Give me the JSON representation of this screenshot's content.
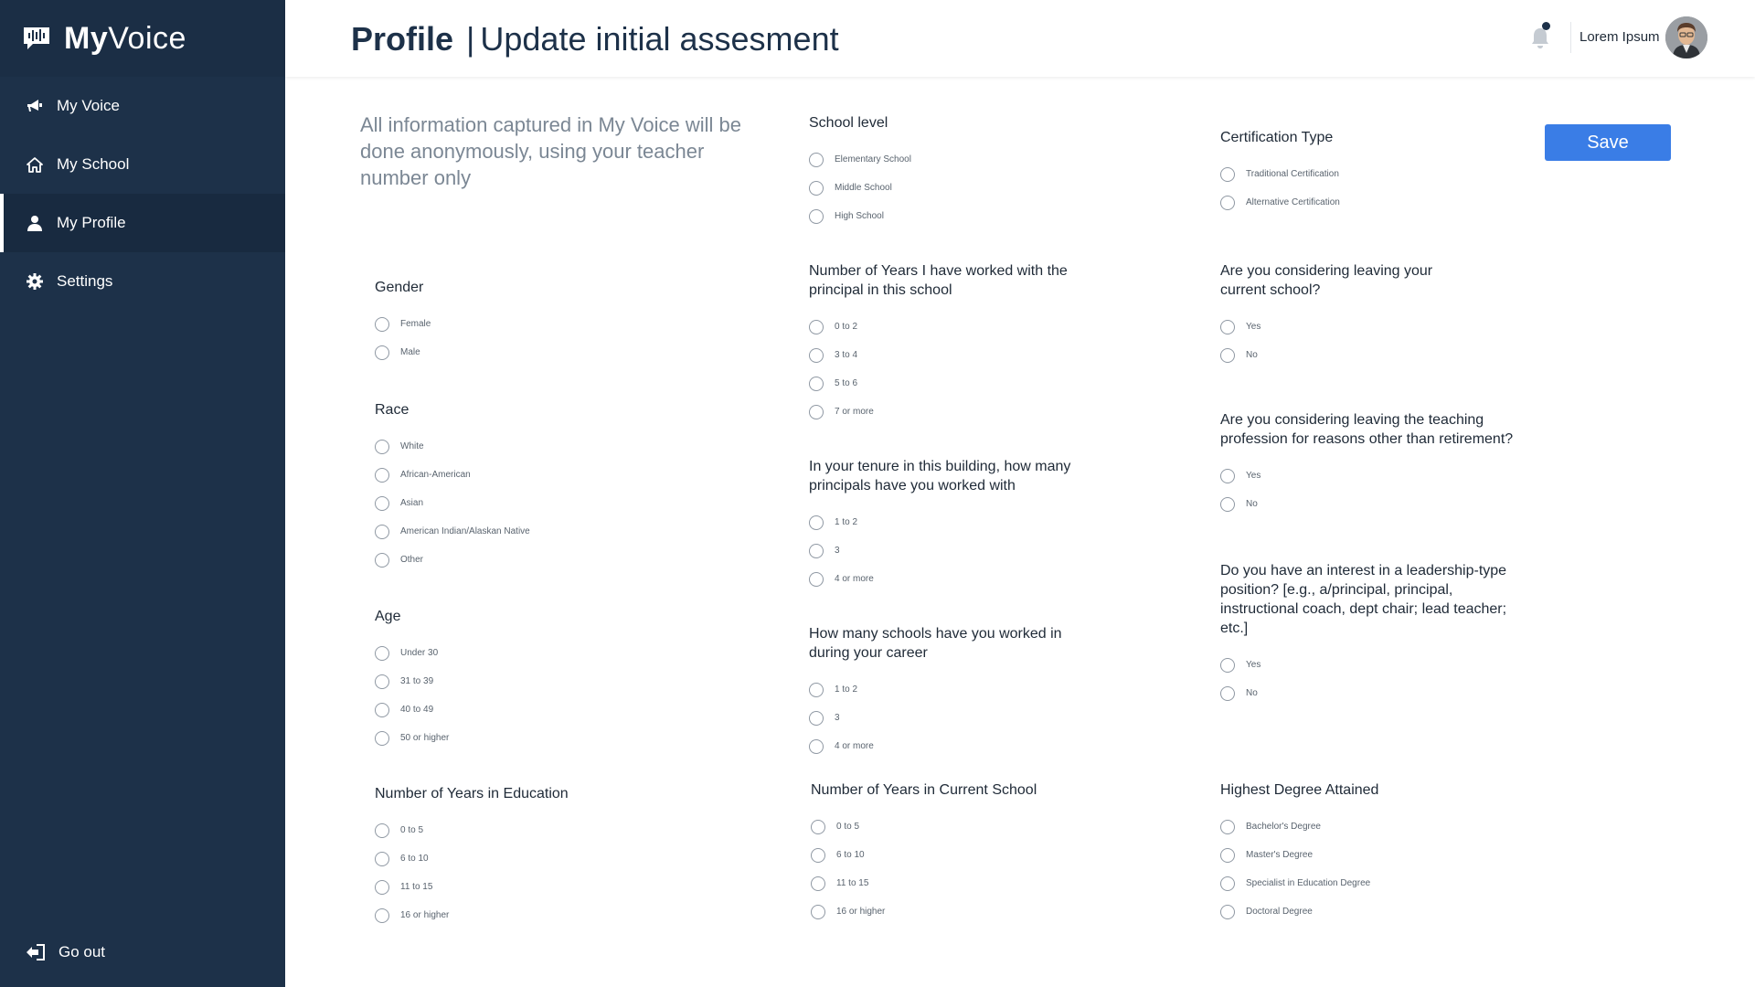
{
  "brand": {
    "my": "My",
    "voice": "Voice"
  },
  "sidebar": {
    "items": [
      {
        "label": "My Voice",
        "icon": "megaphone-icon"
      },
      {
        "label": "My School",
        "icon": "home-icon"
      },
      {
        "label": "My Profile",
        "icon": "user-icon",
        "active": true
      },
      {
        "label": "Settings",
        "icon": "gear-icon"
      }
    ],
    "goout": {
      "label": "Go out",
      "icon": "sign-out-icon"
    }
  },
  "header": {
    "title": "Profile",
    "separator": "|",
    "subtitle": "Update initial assesment",
    "user_name": "Lorem Ipsum"
  },
  "colors": {
    "sidebar": "#1d3149",
    "accent": "#3a7de6",
    "muted_text": "#7b8794"
  },
  "main": {
    "intro": "All information captured in My Voice will be done anonymously, using your teacher number only",
    "save_label": "Save",
    "school_level": {
      "q": "School level",
      "options": [
        "Elementary School",
        "Middle School",
        "High School"
      ]
    },
    "certification": {
      "q": "Certification Type",
      "options": [
        "Traditional Certification",
        "Alternative Certification"
      ]
    },
    "gender": {
      "q": "Gender",
      "options": [
        "Female",
        "Male"
      ]
    },
    "years_principal": {
      "q": "Number of Years I have worked with the principal in this school",
      "options": [
        "0 to 2",
        "3 to 4",
        "5 to 6",
        "7 or more"
      ]
    },
    "leaving_school": {
      "q": "Are you considering leaving your current school?",
      "options": [
        "Yes",
        "No"
      ]
    },
    "race": {
      "q": "Race",
      "options": [
        "White",
        "African-American",
        "Asian",
        "American Indian/Alaskan Native",
        "Other"
      ]
    },
    "leaving_profession": {
      "q": "Are you considering leaving the teaching profession for reasons other than retirement?",
      "options": [
        "Yes",
        "No"
      ]
    },
    "principals_count": {
      "q": "In your tenure in this building, how many principals have you worked with",
      "options": [
        "1 to 2",
        "3",
        "4 or more"
      ]
    },
    "leadership": {
      "q": "Do you have an interest in a leadership-type position? [e.g., a/principal, principal, instructional coach, dept chair; lead teacher; etc.]",
      "options": [
        "Yes",
        "No"
      ]
    },
    "age": {
      "q": "Age",
      "options": [
        "Under 30",
        "31 to 39",
        "40 to 49",
        "50 or higher"
      ]
    },
    "schools_worked": {
      "q": "How many schools have you worked in during your career",
      "options": [
        "1 to 2",
        "3",
        "4 or more"
      ]
    },
    "years_education": {
      "q": "Number of Years in Education",
      "options": [
        "0 to 5",
        "6 to 10",
        "11 to 15",
        "16 or higher"
      ]
    },
    "years_current": {
      "q": "Number of Years in Current School",
      "options": [
        "0 to 5",
        "6 to 10",
        "11 to 15",
        "16 or higher"
      ]
    },
    "degree": {
      "q": "Highest Degree Attained",
      "options": [
        "Bachelor's Degree",
        "Master's Degree",
        "Specialist in Education Degree",
        "Doctoral Degree"
      ]
    }
  }
}
